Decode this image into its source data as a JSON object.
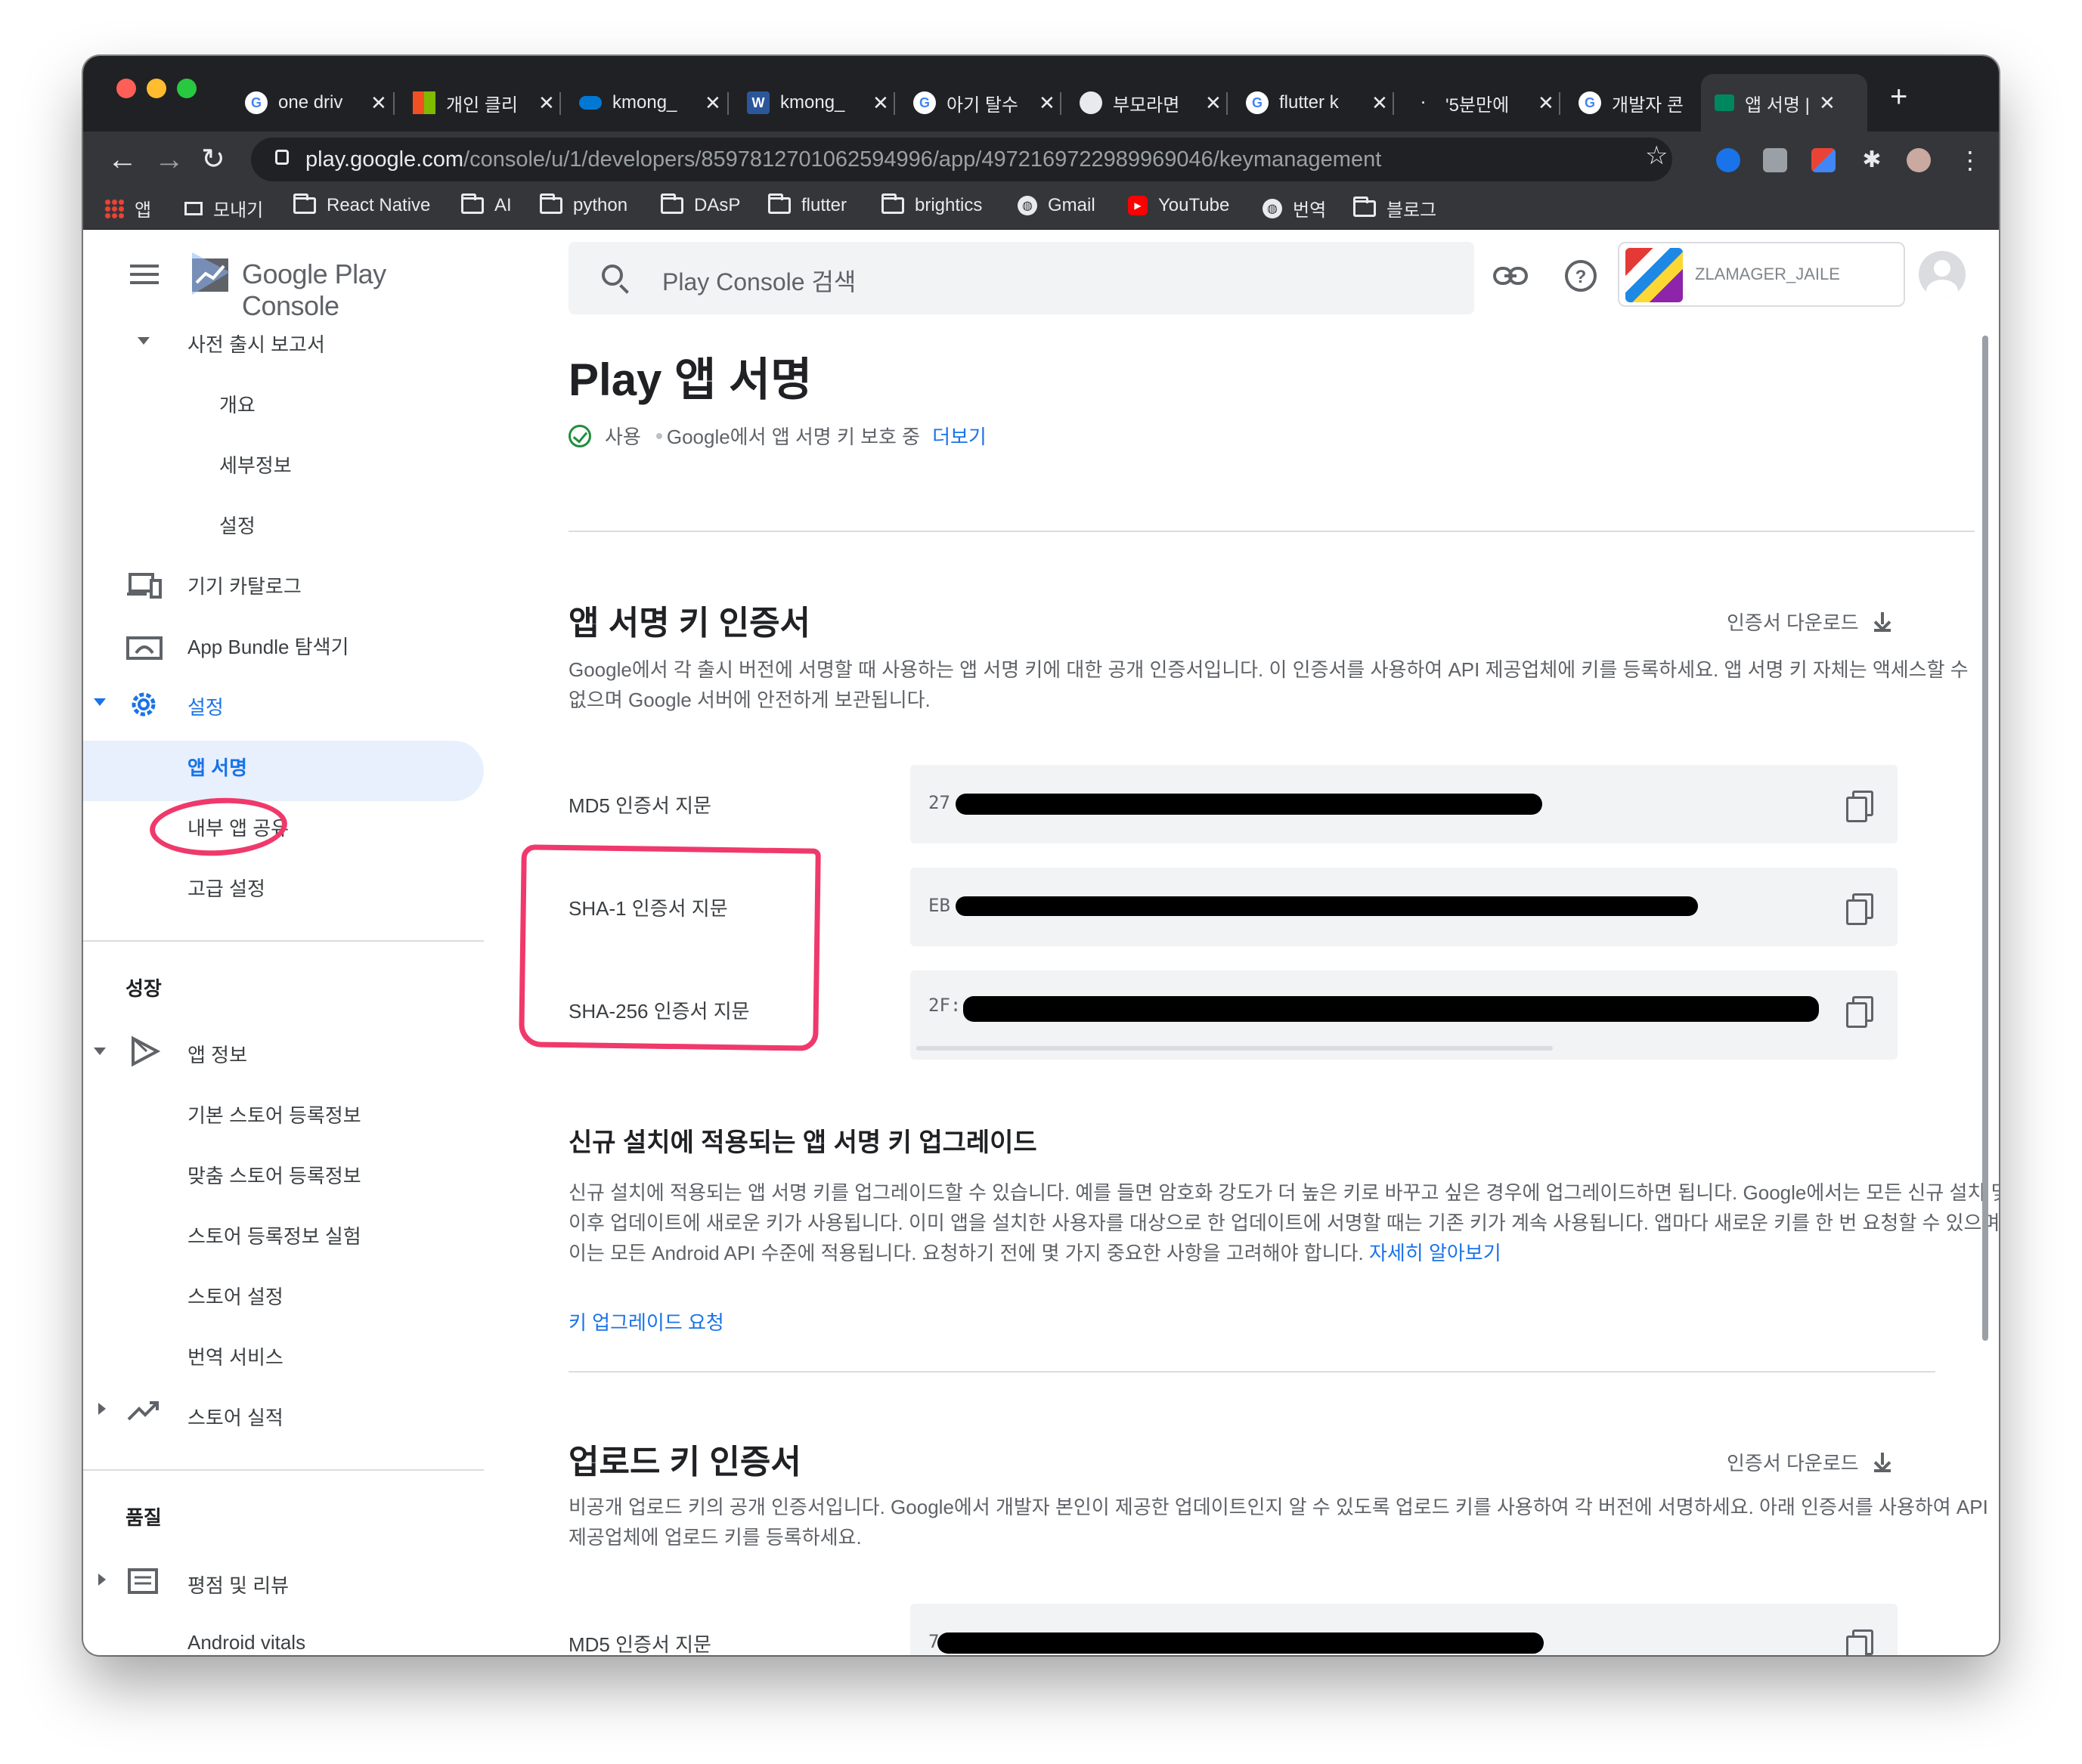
{
  "browser": {
    "tabs": [
      {
        "title": "one driv",
        "favicon": "google-icon",
        "color": "#ffffff"
      },
      {
        "title": "개인 클리",
        "favicon": "microsoft-icon",
        "color": "#f25022"
      },
      {
        "title": "kmong_",
        "favicon": "onedrive-icon",
        "color": "#0078d4"
      },
      {
        "title": "kmong_",
        "favicon": "word-icon",
        "color": "#2b579a"
      },
      {
        "title": "아기 탈수",
        "favicon": "google-icon",
        "color": "#ffffff"
      },
      {
        "title": "부모라면",
        "favicon": "site-icon",
        "color": "#e8eaed"
      },
      {
        "title": "flutter k",
        "favicon": "google-icon",
        "color": "#ffffff"
      },
      {
        "title": "'5분만에",
        "favicon": "site-icon",
        "color": "#202124"
      },
      {
        "title": "개발자 콘",
        "favicon": "google-icon",
        "color": "#ffffff"
      },
      {
        "title": "앱 서명 |",
        "favicon": "play-console-icon",
        "color": "#01875f"
      }
    ],
    "url_host": "play.google.com",
    "url_path": "/console/u/1/developers/8597812701062594996/app/4972169722989969046/keymanagement",
    "bookmarks": [
      "앱",
      "모내기",
      "React Native",
      "AI",
      "python",
      "DAsP",
      "flutter",
      "brightics",
      "Gmail",
      "YouTube",
      "번역",
      "블로그"
    ]
  },
  "sidebar": {
    "logo_text": "Google Play Console",
    "prelaunch": "사전 출시 보고서",
    "prelaunch_items": [
      "개요",
      "세부정보",
      "설정"
    ],
    "device_catalog": "기기 카탈로그",
    "app_bundle": "App Bundle 탐색기",
    "settings": "설정",
    "settings_items": [
      "앱 서명",
      "내부 앱 공유",
      "고급 설정"
    ],
    "growth_section": "성장",
    "app_info": "앱 정보",
    "store_items": [
      "기본 스토어 등록정보",
      "맞춤 스토어 등록정보",
      "스토어 등록정보 실험",
      "스토어 설정",
      "번역 서비스"
    ],
    "store_performance": "스토어 실적",
    "quality_section": "품질",
    "ratings": "평점 및 리뷰",
    "android_vitals": "Android vitals"
  },
  "topbar": {
    "search_placeholder": "Play Console 검색",
    "account_name": "ZLAMAGER_JAILE"
  },
  "main": {
    "title": "Play 앱 서명",
    "status_text": "사용",
    "status_sub": "Google에서 앱 서명 키 보호 중",
    "more_link": "더보기",
    "signing_cert": {
      "heading": "앱 서명 키 인증서",
      "download": "인증서 다운로드",
      "description": "Google에서 각 출시 버전에 서명할 때 사용하는 앱 서명 키에 대한 공개 인증서입니다. 이 인증서를 사용하여 API 제공업체에 키를 등록하세요. 앱 서명 키 자체는 액세스할 수 없으며 Google 서버에 안전하게 보관됩니다.",
      "md5_label": "MD5 인증서 지문",
      "md5_value": "27",
      "sha1_label": "SHA-1 인증서 지문",
      "sha1_value": "EB",
      "sha256_label": "SHA-256 인증서 지문",
      "sha256_value": "2F:"
    },
    "upgrade": {
      "heading": "신규 설치에 적용되는 앱 서명 키 업그레이드",
      "description": "신규 설치에 적용되는 앱 서명 키를 업그레이드할 수 있습니다. 예를 들면 암호화 강도가 더 높은 키로 바꾸고 싶은 경우에 업그레이드하면 됩니다. Google에서는 모든 신규 설치 및 이후 업데이트에 새로운 키가 사용됩니다. 이미 앱을 설치한 사용자를 대상으로 한 업데이트에 서명할 때는 기존 키가 계속 사용됩니다. 앱마다 새로운 키를 한 번 요청할 수 있으며 이는 모든 Android API 수준에 적용됩니다. 요청하기 전에 몇 가지 중요한 사항을 고려해야 합니다.",
      "learn_more": "자세히 알아보기",
      "request_link": "키 업그레이드 요청"
    },
    "upload_cert": {
      "heading": "업로드 키 인증서",
      "download": "인증서 다운로드",
      "description": "비공개 업로드 키의 공개 인증서입니다. Google에서 개발자 본인이 제공한 업데이트인지 알 수 있도록 업로드 키를 사용하여 각 버전에 서명하세요. 아래 인증서를 사용하여 API 제공업체에 업로드 키를 등록하세요.",
      "md5_label": "MD5 인증서 지문",
      "md5_value": "7"
    }
  }
}
